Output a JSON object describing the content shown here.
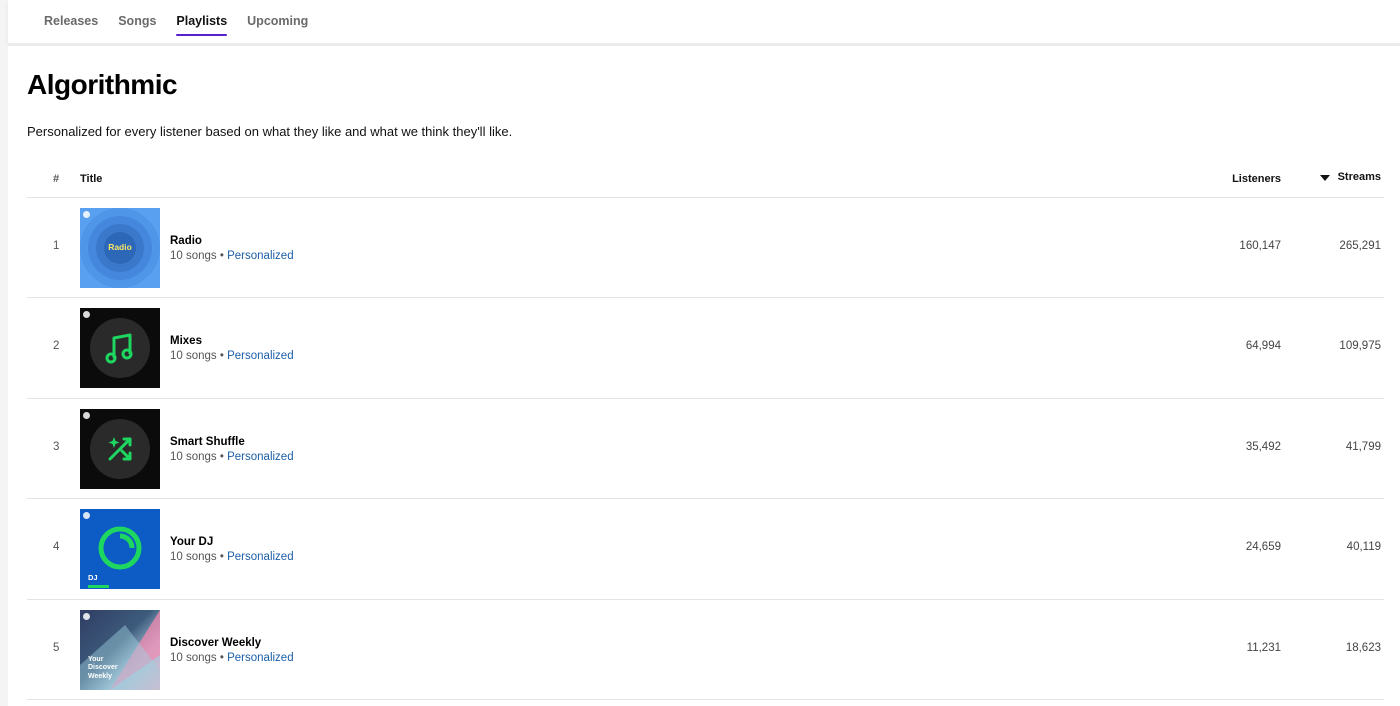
{
  "tabs": [
    {
      "label": "Releases",
      "active": false
    },
    {
      "label": "Songs",
      "active": false
    },
    {
      "label": "Playlists",
      "active": true
    },
    {
      "label": "Upcoming",
      "active": false
    }
  ],
  "section": {
    "title": "Algorithmic",
    "description": "Personalized for every listener based on what they like and what we think they'll like."
  },
  "table": {
    "headers": {
      "num": "#",
      "title": "Title",
      "listeners": "Listeners",
      "streams": "Streams"
    },
    "sort": {
      "column": "Streams",
      "direction": "descending"
    },
    "rows": [
      {
        "num": "1",
        "name": "Radio",
        "songs": "10 songs",
        "tag": "Personalized",
        "listeners": "160,147",
        "streams": "265,291",
        "cover_label": "Radio"
      },
      {
        "num": "2",
        "name": "Mixes",
        "songs": "10 songs",
        "tag": "Personalized",
        "listeners": "64,994",
        "streams": "109,975",
        "cover_label": ""
      },
      {
        "num": "3",
        "name": "Smart Shuffle",
        "songs": "10 songs",
        "tag": "Personalized",
        "listeners": "35,492",
        "streams": "41,799",
        "cover_label": ""
      },
      {
        "num": "4",
        "name": "Your DJ",
        "songs": "10 songs",
        "tag": "Personalized",
        "listeners": "24,659",
        "streams": "40,119",
        "cover_label": "DJ"
      },
      {
        "num": "5",
        "name": "Discover Weekly",
        "songs": "10 songs",
        "tag": "Personalized",
        "listeners": "11,231",
        "streams": "18,623",
        "cover_label": "Your Discover Weekly"
      }
    ]
  },
  "colors": {
    "accent": "#5a1fd1",
    "link": "#1b5ea7",
    "spotify_green": "#1ed760",
    "radio_blue": "#5aa0f0",
    "dj_blue": "#0d5bc4"
  }
}
